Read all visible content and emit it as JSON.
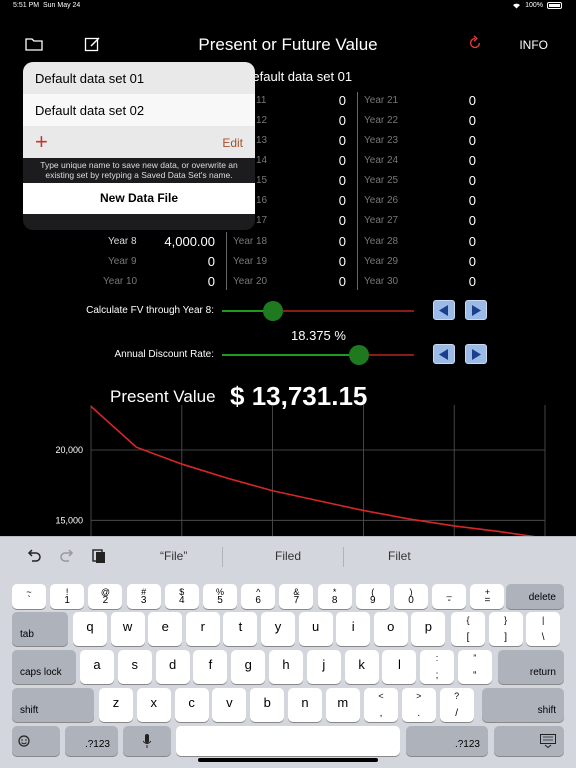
{
  "status": {
    "time": "5:51 PM",
    "date": "Sun May 24",
    "battery": "100%"
  },
  "nav": {
    "title": "Present or Future Value",
    "info": "INFO",
    "accent": "#e53935"
  },
  "table": {
    "data_set_title": "Default data set 01",
    "col2_partial_years": [
      "11",
      "12",
      "13",
      "14",
      "15",
      "16",
      "17"
    ],
    "col2": [
      {
        "year": "Year 18",
        "value": "0"
      },
      {
        "year": "Year 19",
        "value": "0"
      },
      {
        "year": "Year 20",
        "value": "0"
      }
    ],
    "col2_values_top": [
      "0",
      "0",
      "0",
      "0",
      "0",
      "0",
      "0"
    ],
    "col3": [
      {
        "year": "Year 21",
        "value": "0"
      },
      {
        "year": "Year 22",
        "value": "0"
      },
      {
        "year": "Year 23",
        "value": "0"
      },
      {
        "year": "Year 24",
        "value": "0"
      },
      {
        "year": "Year 25",
        "value": "0"
      },
      {
        "year": "Year 26",
        "value": "0"
      },
      {
        "year": "Year 27",
        "value": "0"
      },
      {
        "year": "Year 28",
        "value": "0"
      },
      {
        "year": "Year 29",
        "value": "0"
      },
      {
        "year": "Year 30",
        "value": "0"
      }
    ],
    "col1": [
      {
        "year": "Year 8",
        "value": "4,000.00"
      },
      {
        "year": "Year 9",
        "value": "0"
      },
      {
        "year": "Year 10",
        "value": "0"
      }
    ]
  },
  "popover": {
    "items": [
      "Default data set 01",
      "Default data set 02"
    ],
    "add": "+",
    "edit": "Edit",
    "hint": "Type unique name to save new data, or overwrite an existing set by retyping a Saved Data Set's name.",
    "new_file": "New Data File"
  },
  "controls": {
    "fv_label": "Calculate FV through Year 8:",
    "fv_position": 0.26,
    "rate_value": "18.375 %",
    "rate_label": "Annual Discount Rate:",
    "rate_position": 0.72
  },
  "result": {
    "label": "Present Value",
    "currency": "$",
    "value": "13,731.15"
  },
  "chart_data": {
    "type": "line",
    "yticks": [
      "20,000",
      "15,000"
    ],
    "y_tick_values": [
      20000,
      15000
    ],
    "ylim": [
      13600,
      23200
    ],
    "xlim": [
      0,
      1
    ],
    "grid": true,
    "series": [
      {
        "x": [
          0.0,
          0.1,
          0.2,
          0.3,
          0.4,
          0.5,
          0.6,
          0.7,
          0.8,
          0.9,
          1.0
        ],
        "values": [
          23100,
          20200,
          19000,
          18000,
          17100,
          16400,
          15700,
          15100,
          14600,
          14200,
          13731
        ]
      }
    ],
    "line_color": "#d62728",
    "marker_color": "#2ecc40"
  },
  "keyboard": {
    "suggestions": [
      "“File”",
      "Filed",
      "Filet"
    ],
    "row1": [
      [
        "~",
        "`"
      ],
      [
        "!",
        "1"
      ],
      [
        "@",
        "2"
      ],
      [
        "#",
        "3"
      ],
      [
        "$",
        "4"
      ],
      [
        "%",
        "5"
      ],
      [
        "^",
        "6"
      ],
      [
        "&",
        "7"
      ],
      [
        "*",
        "8"
      ],
      [
        "(",
        "9"
      ],
      [
        ")",
        "0"
      ],
      [
        "_",
        "-"
      ],
      [
        "+",
        "="
      ]
    ],
    "row2": [
      "q",
      "w",
      "e",
      "r",
      "t",
      "y",
      "u",
      "i",
      "o",
      "p"
    ],
    "row2_extra": [
      [
        "{",
        "["
      ],
      [
        "}",
        "]"
      ],
      [
        "|",
        "\\"
      ]
    ],
    "row3": [
      "a",
      "s",
      "d",
      "f",
      "g",
      "h",
      "j",
      "k",
      "l"
    ],
    "row3_extra": [
      [
        ":",
        ";"
      ],
      [
        "”",
        "“"
      ]
    ],
    "row4": [
      "z",
      "x",
      "c",
      "v",
      "b",
      "n",
      "m"
    ],
    "row4_extra": [
      [
        "<",
        ","
      ],
      [
        ">",
        "."
      ],
      [
        "?",
        "/"
      ]
    ],
    "delete": "delete",
    "tab": "tab",
    "caps": "caps lock",
    "return": "return",
    "shift": "shift",
    "numbers": ".?123"
  }
}
